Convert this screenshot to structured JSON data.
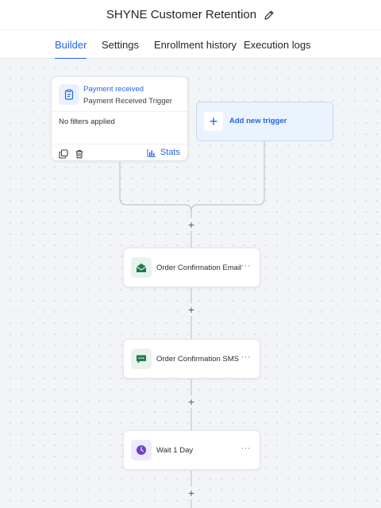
{
  "header": {
    "title": "SHYNE Customer Retention",
    "edit_icon": "pencil-icon"
  },
  "tabs": [
    {
      "label": "Builder",
      "active": true
    },
    {
      "label": "Settings",
      "active": false
    },
    {
      "label": "Enrollment history",
      "active": false
    },
    {
      "label": "Execution logs",
      "active": false
    }
  ],
  "trigger": {
    "title": "Payment received",
    "subtitle": "Payment Received Trigger",
    "filters": "No filters applied",
    "stats_label": "Stats",
    "icon": "clipboard-icon"
  },
  "add_trigger": {
    "label": "Add new trigger",
    "icon": "plus-icon"
  },
  "plus_symbol": "+",
  "steps": [
    {
      "label": "Order Confirmation Email",
      "icon": "email-icon",
      "menu": "···"
    },
    {
      "label": "Order Confirmation SMS",
      "icon": "sms-icon",
      "menu": "···"
    },
    {
      "label": "Wait 1 Day",
      "icon": "clock-icon",
      "menu": "···"
    }
  ],
  "colors": {
    "accent": "#2563eb",
    "email_green": "#1f7a4d",
    "sms_green": "#1f7a4d",
    "wait_purple": "#6d3fd8",
    "connector": "#b8bcc4"
  }
}
